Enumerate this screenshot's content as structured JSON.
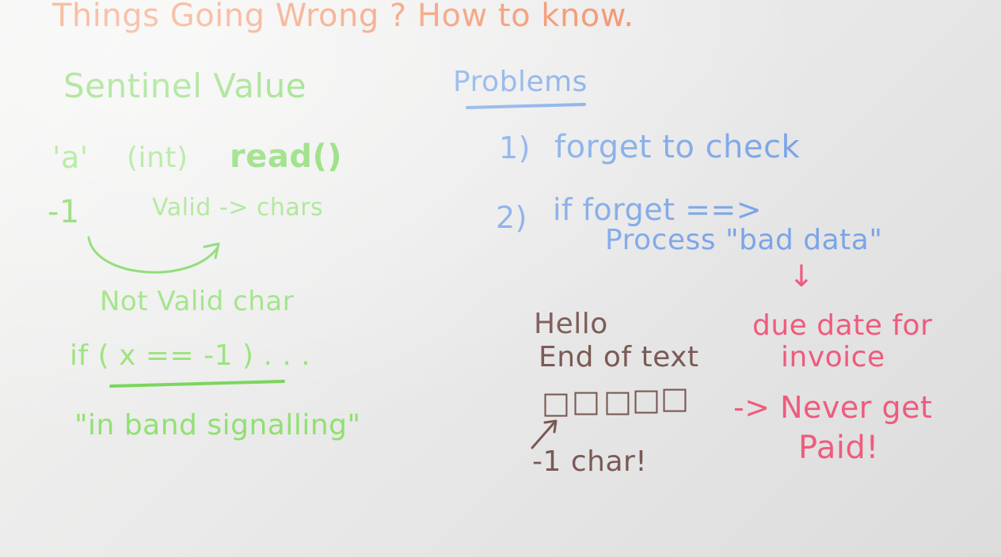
{
  "title": "Things Going Wrong ? How to know.",
  "left": {
    "heading": "Sentinel Value",
    "line1_a": "'a'",
    "line1_b": "(int)",
    "line1_c": "read()",
    "minus_one": "-1",
    "valid_chars": "Valid -> chars",
    "not_valid": "Not Valid char",
    "if_check": "if ( x == -1 ) . . .",
    "in_band": "\"in band signalling\""
  },
  "right": {
    "heading": "Problems",
    "p1_num": "1)",
    "p1_text": "forget to check",
    "p2_num": "2)",
    "p2_text": "if forget ==>",
    "p2_text2": "Process \"bad data\"",
    "arrow_down": "↓",
    "due_date": "due date for",
    "invoice": "invoice",
    "never": "-> Never get",
    "paid": "Paid!"
  },
  "example": {
    "hello": "Hello",
    "end_of_text": "End of text",
    "boxes": [
      "□",
      "□",
      "□",
      "□",
      "□"
    ],
    "minus_char": "-1 char!"
  },
  "colors": {
    "orange": "#f2875a",
    "green": "#6fd24e",
    "blue": "#7aa5e8",
    "brown": "#7a5a55",
    "red": "#ef5b7d"
  }
}
